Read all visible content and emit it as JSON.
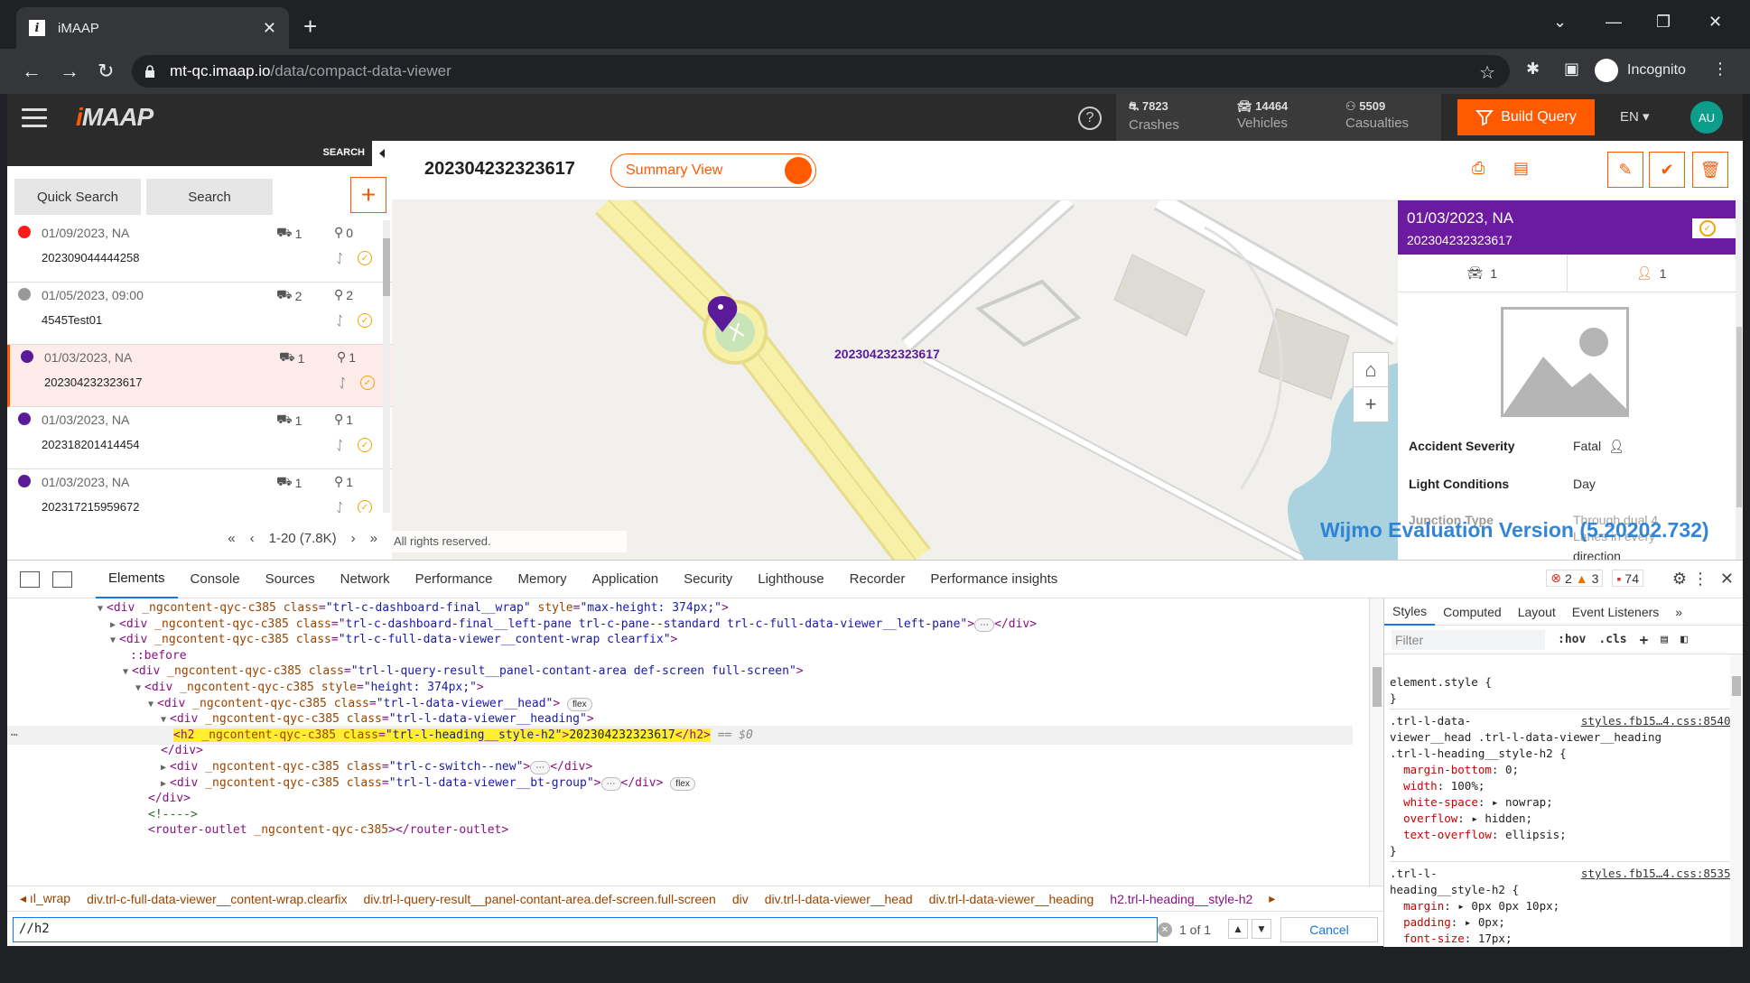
{
  "browser": {
    "tab_title": "iMAAP",
    "tab_favicon": "i",
    "url_host": "mt-qc.imaap.io",
    "url_path": "/data/compact-data-viewer",
    "profile_label": "Incognito"
  },
  "header": {
    "logo_prefix": "i",
    "logo_rest": "MAAP",
    "help": "?",
    "stats": [
      {
        "num": "7823",
        "label": "Crashes",
        "icon": "crash-icon"
      },
      {
        "num": "14464",
        "label": "Vehicles",
        "icon": "car-icon"
      },
      {
        "num": "5509",
        "label": "Casualties",
        "icon": "person-icon"
      }
    ],
    "build_query": "Build Query",
    "language": "EN",
    "avatar": "AU",
    "accent": "#ff5a00"
  },
  "left": {
    "search_label": "SEARCH",
    "quick_search": "Quick Search",
    "search": "Search",
    "add": "+",
    "items": [
      {
        "date": "01/09/2023, NA",
        "id": "202309044444258",
        "vehicles": "1",
        "casualties": "0",
        "dot": "#ff1a1a",
        "active": false
      },
      {
        "date": "01/05/2023, 09:00",
        "id": "4545Test01",
        "vehicles": "2",
        "casualties": "2",
        "dot": "#999999",
        "active": false
      },
      {
        "date": "01/03/2023, NA",
        "id": "202304232323617",
        "vehicles": "1",
        "casualties": "1",
        "dot": "#5a1a9a",
        "active": true
      },
      {
        "date": "01/03/2023, NA",
        "id": "202318201414454",
        "vehicles": "1",
        "casualties": "1",
        "dot": "#5a1a9a",
        "active": false
      },
      {
        "date": "01/03/2023, NA",
        "id": "202317215959672",
        "vehicles": "1",
        "casualties": "1",
        "dot": "#5a1a9a",
        "active": false
      }
    ],
    "pager_range": "1-20 (7.8K)"
  },
  "main": {
    "title": "202304232323617",
    "switch_label": "Summary View",
    "map_marker_label": "202304232323617",
    "copyright": "All rights reserved.",
    "watermark": "Wijmo Evaluation Version (5.20202.732)"
  },
  "detail": {
    "date": "01/03/2023, NA",
    "id": "202304232323617",
    "vehicles": "1",
    "casualties": "1",
    "rows": [
      {
        "key": "Accident Severity",
        "value": "Fatal"
      },
      {
        "key": "Light Conditions",
        "value": "Day"
      },
      {
        "key": "Junction Type",
        "value": "Through dual 4"
      },
      {
        "key": "",
        "value": "direction"
      }
    ],
    "partial_value": "Lanes in every"
  },
  "devtools": {
    "tabs": [
      "Elements",
      "Console",
      "Sources",
      "Network",
      "Performance",
      "Memory",
      "Application",
      "Security",
      "Lighthouse",
      "Recorder",
      "Performance insights"
    ],
    "errors": "2",
    "warnings": "3",
    "issues": "74",
    "lines": [
      {
        "indent": 100,
        "arrow": "▼",
        "html": "div_wrap"
      },
      {
        "indent": 114,
        "arrow": "▶",
        "html": "div_left"
      },
      {
        "indent": 114,
        "arrow": "▼",
        "html": "div_content"
      },
      {
        "indent": 136,
        "arrow": "",
        "html": "before"
      },
      {
        "indent": 128,
        "arrow": "▼",
        "html": "div_query"
      },
      {
        "indent": 142,
        "arrow": "▼",
        "html": "div_height"
      },
      {
        "indent": 156,
        "arrow": "▼",
        "html": "div_head"
      },
      {
        "indent": 170,
        "arrow": "▼",
        "html": "div_heading"
      },
      {
        "indent": 184,
        "arrow": "",
        "html": "h2"
      },
      {
        "indent": 170,
        "arrow": "",
        "html": "close_div"
      },
      {
        "indent": 170,
        "arrow": "▶",
        "html": "div_switch"
      },
      {
        "indent": 170,
        "arrow": "▶",
        "html": "div_btgroup"
      },
      {
        "indent": 156,
        "arrow": "",
        "html": "close_div2"
      },
      {
        "indent": 156,
        "arrow": "",
        "html": "comment"
      },
      {
        "indent": 156,
        "arrow": "",
        "html": "router"
      }
    ],
    "breadcrumbs": [
      "◂ ıl_wrap",
      "div.trl-c-full-data-viewer__content-wrap.clearfix",
      "div.trl-l-query-result__panel-contant-area.def-screen.full-screen",
      "div",
      "div.trl-l-data-viewer__head",
      "div.trl-l-data-viewer__heading",
      "h2.trl-l-heading__style-h2",
      "▸"
    ],
    "find_value": "//h2",
    "find_count": "1 of 1",
    "cancel": "Cancel",
    "styles_tabs": [
      "Styles",
      "Computed",
      "Layout",
      "Event Listeners",
      "»"
    ],
    "filter_placeholder": "Filter",
    "hov": ":hov",
    "cls": ".cls"
  }
}
